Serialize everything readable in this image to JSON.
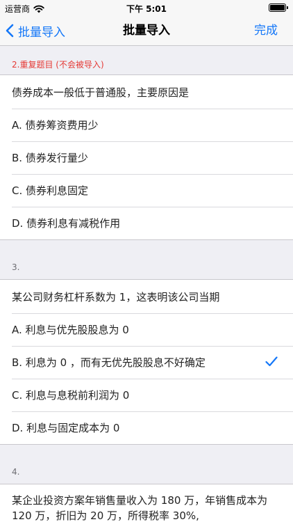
{
  "status": {
    "carrier": "运营商",
    "time": "下午 5:01"
  },
  "nav": {
    "back_label": "批量导入",
    "title": "批量导入",
    "done_label": "完成"
  },
  "sections": [
    {
      "header": "2.重复题目 (不会被导入)",
      "question": "债券成本一般低于普通股，主要原因是",
      "options": [
        "A. 债券筹资费用少",
        "B. 债券发行量少",
        "C. 债券利息固定",
        "D. 债券利息有减税作用"
      ]
    },
    {
      "header": "3.",
      "question": "某公司财务杠杆系数为 1，这表明该公司当期",
      "options": [
        "A. 利息与优先股股息为 0",
        "B. 利息为 0 ，而有无优先股股息不好确定",
        "C. 利息与息税前利润为 0",
        "D. 利息与固定成本为 0"
      ],
      "selected": 1
    },
    {
      "header": "4.",
      "question": "某企业投资方案年销售量收入为 180 万，年销售成本为 120 万，折旧为 20 万，所得税率 30%,"
    }
  ]
}
